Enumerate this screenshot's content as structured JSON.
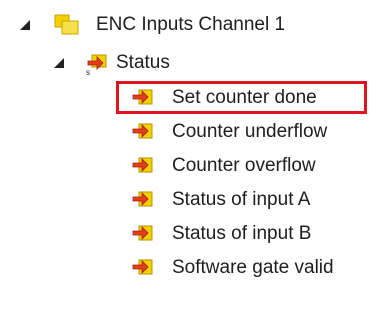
{
  "tree": {
    "root": {
      "label": "ENC Inputs Channel 1",
      "icon": "yellow-folder-icon",
      "expanded": true
    },
    "group": {
      "label": "Status",
      "icon": "input-group-icon",
      "expanded": true
    },
    "items": [
      {
        "label": "Set counter done",
        "icon": "input-variable-icon",
        "highlighted": true
      },
      {
        "label": "Counter underflow",
        "icon": "input-variable-icon",
        "highlighted": false
      },
      {
        "label": "Counter overflow",
        "icon": "input-variable-icon",
        "highlighted": false
      },
      {
        "label": "Status of input A",
        "icon": "input-variable-icon",
        "highlighted": false
      },
      {
        "label": "Status of input B",
        "icon": "input-variable-icon",
        "highlighted": false
      },
      {
        "label": "Software gate valid",
        "icon": "input-variable-icon",
        "highlighted": false
      }
    ]
  },
  "colors": {
    "highlight_border": "#e0141e",
    "icon_yellow": "#f5d000",
    "icon_red": "#e53c1e",
    "text": "#1e1e1e"
  }
}
